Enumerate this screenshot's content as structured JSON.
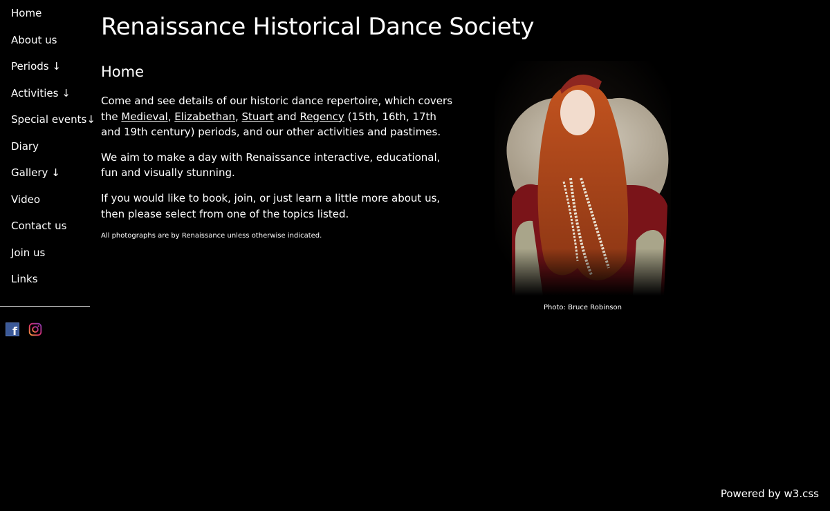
{
  "nav": {
    "items": [
      {
        "label": "Home"
      },
      {
        "label": "About us"
      },
      {
        "label": "Periods ↓"
      },
      {
        "label": "Activities ↓"
      },
      {
        "label": "Special events↓"
      },
      {
        "label": "Diary"
      },
      {
        "label": "Gallery ↓"
      },
      {
        "label": "Video"
      },
      {
        "label": "Contact us"
      },
      {
        "label": "Join us"
      },
      {
        "label": "Links"
      }
    ]
  },
  "social": {
    "facebook": {
      "icon": "facebook-icon",
      "color": "#3b5998",
      "glyph": "f"
    },
    "instagram": {
      "icon": "instagram-icon"
    }
  },
  "header": {
    "title": "Renaissance Historical Dance Society"
  },
  "main": {
    "heading": "Home",
    "para1": {
      "before": "Come and see details of our historic dance repertoire, which covers the ",
      "link_medieval": "Medieval",
      "sep1": ", ",
      "link_elizabethan": "Elizabethan",
      "sep2": ", ",
      "link_stuart": "Stuart",
      "sep3": " and ",
      "link_regency": "Regency",
      "after": " (15th, 16th, 17th and 19th century) periods, and our other activities and pastimes."
    },
    "para2": "We aim to make a day with Renaissance interactive, educational, fun and visually stunning.",
    "para3": "If you would like to book, join, or just learn a little more about us, then please select from one of the topics listed.",
    "note": "All photographs are by Renaissance unless otherwise indicated."
  },
  "photo": {
    "caption": "Photo: Bruce Robinson"
  },
  "footer": {
    "powered": "Powered by w3.css"
  }
}
